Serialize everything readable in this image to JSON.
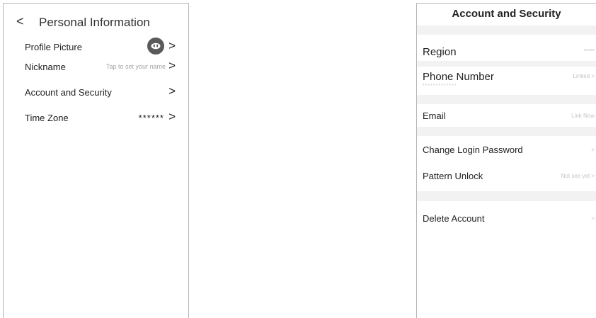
{
  "personal": {
    "title": "Personal Information",
    "back": "<",
    "rows": [
      {
        "label": "Profile Picture",
        "chevron": ">"
      },
      {
        "label": "Nickname",
        "hint": "Tap to set your name",
        "chevron": ">"
      },
      {
        "label": "Account and Security",
        "chevron": ">"
      },
      {
        "label": "Time Zone",
        "value": "******",
        "chevron": ">"
      }
    ]
  },
  "security": {
    "title": "Account and Security",
    "rows": [
      {
        "label": "Region",
        "hint": "*****"
      },
      {
        "label": "Phone Number",
        "hint": "Linked >",
        "sub": "*************"
      },
      {
        "label": "Email",
        "hint": "Link Now"
      },
      {
        "label": "Change Login Password",
        "hint": ">"
      },
      {
        "label": "Pattern Unlock",
        "hint": "Not see yet >"
      },
      {
        "label": "Delete Account",
        "hint": ">"
      }
    ]
  },
  "colors": {
    "border": "#b5b5b5",
    "section_gap": "#f2f2f2",
    "hint_text": "#a5a5a5",
    "avatar_bg": "#5a5a5a"
  }
}
